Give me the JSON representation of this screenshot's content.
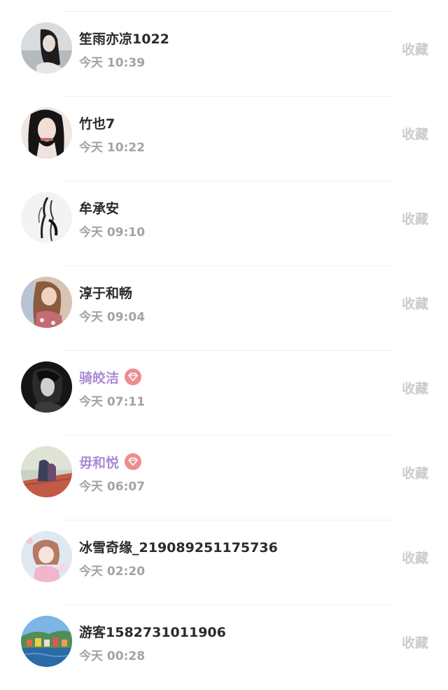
{
  "rows": [
    {
      "name": "笙雨亦凉1022",
      "time": "今天 10:39",
      "action": "收藏",
      "vip": false
    },
    {
      "name": "竹也7",
      "time": "今天 10:22",
      "action": "收藏",
      "vip": false
    },
    {
      "name": "牟承安",
      "time": "今天 09:10",
      "action": "收藏",
      "vip": false
    },
    {
      "name": "淳于和畅",
      "time": "今天 09:04",
      "action": "收藏",
      "vip": false
    },
    {
      "name": "骑皎洁",
      "time": "今天 07:11",
      "action": "收藏",
      "vip": true
    },
    {
      "name": "毋和悦",
      "time": "今天 06:07",
      "action": "收藏",
      "vip": true
    },
    {
      "name": "冰雪奇缘_219089251175736",
      "time": "今天 02:20",
      "action": "收藏",
      "vip": false
    },
    {
      "name": "游客1582731011906",
      "time": "今天 00:28",
      "action": "收藏",
      "vip": false
    }
  ],
  "colors": {
    "name": "#2b2b2b",
    "vip_name": "#a98bd6",
    "vip_badge": "#ec8d90",
    "time": "#a3a3a3",
    "action": "#cccccc"
  },
  "icons": {
    "vip_badge": "diamond-icon"
  }
}
